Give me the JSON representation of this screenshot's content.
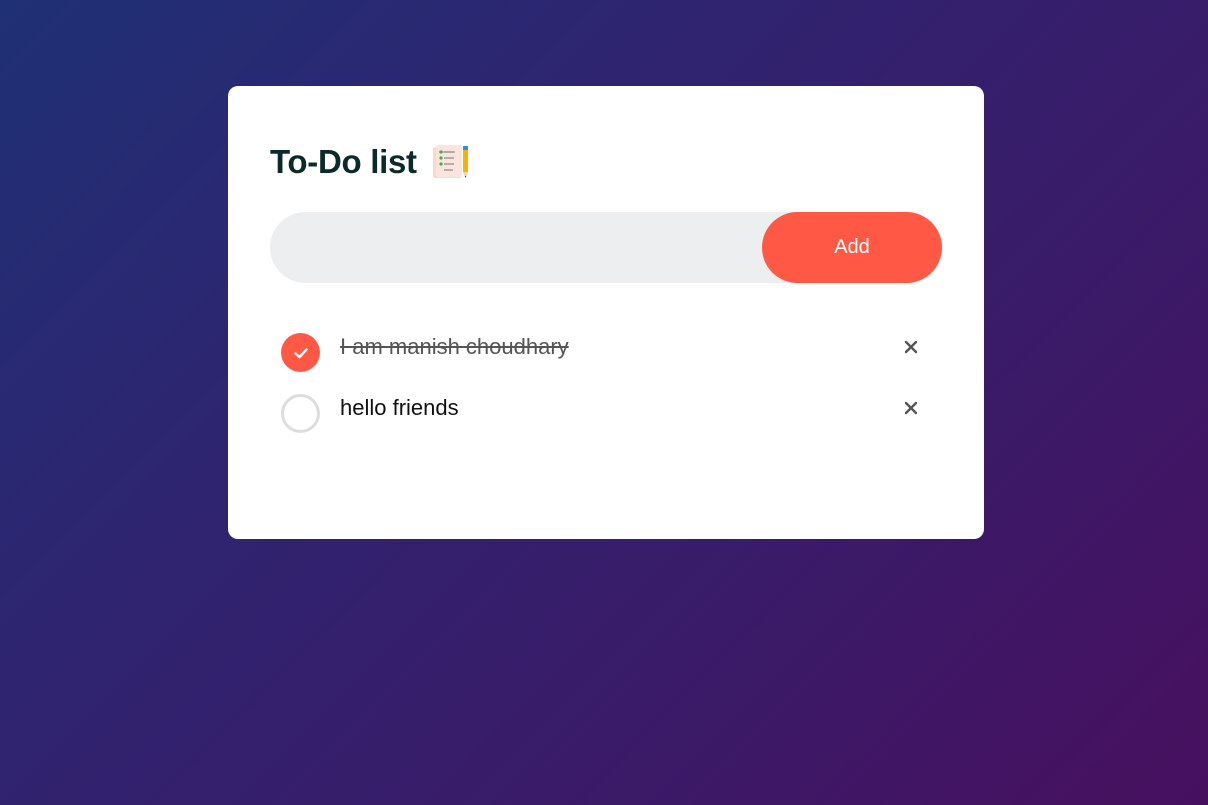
{
  "app": {
    "title": "To-Do list",
    "title_icon": "notepad-with-pencil-icon"
  },
  "input": {
    "value": "",
    "placeholder": "",
    "add_label": "Add"
  },
  "tasks": [
    {
      "text": "I am manish choudhary",
      "done": true
    },
    {
      "text": "hello friends",
      "done": false
    }
  ],
  "colors": {
    "accent": "#ff5945",
    "title": "#0b2a2a",
    "input_bg": "#edeef0",
    "bg_start": "#1f3074",
    "bg_end": "#47105f"
  }
}
